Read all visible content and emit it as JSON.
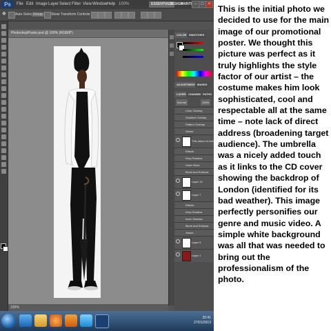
{
  "photoshop": {
    "logo": "Ps",
    "menu": [
      "File",
      "Edit",
      "Image",
      "Layer",
      "Select",
      "Filter",
      "View",
      "Window",
      "Help"
    ],
    "zoom": "100%",
    "workspaces": [
      "ESSENTIALS",
      "DESIGN",
      "PAINTING"
    ],
    "options_bar": {
      "auto_select": "Auto-Select:",
      "auto_select_value": "Group",
      "transform": "Show Transform Controls"
    },
    "document_tab": "PhotoshopPoster.psd @ 100% (RGB/8*)",
    "status_zoom": "100%",
    "panels": {
      "color_tabs": [
        "COLOR",
        "SWATCHES"
      ],
      "adjust_tabs": [
        "ADJUSTMENTS",
        "MASKS"
      ],
      "layers_tabs": [
        "LAYERS",
        "CHANNELS",
        "PATHS"
      ],
      "blend_mode": "Normal",
      "opacity": "100%",
      "layers": [
        {
          "name": "Color Overlay",
          "sub": true
        },
        {
          "name": "Gradient Overlay",
          "sub": true
        },
        {
          "name": "Pattern Overlay",
          "sub": true
        },
        {
          "name": "Stroke",
          "sub": true
        },
        {
          "name": "This album is included...",
          "sub": false
        },
        {
          "name": "Effects",
          "sub": true
        },
        {
          "name": "Drop Shadow",
          "sub": true
        },
        {
          "name": "Outer Glow",
          "sub": true
        },
        {
          "name": "Bevel and Emboss",
          "sub": true
        },
        {
          "name": "Layer 10",
          "sub": false
        },
        {
          "name": "Layer 7",
          "sub": false
        },
        {
          "name": "Effects",
          "sub": true
        },
        {
          "name": "Drop Shadow",
          "sub": true
        },
        {
          "name": "Inner Shadow",
          "sub": true
        },
        {
          "name": "Bevel and Emboss",
          "sub": true
        },
        {
          "name": "Stroke",
          "sub": true
        },
        {
          "name": "Layer 5",
          "sub": false
        },
        {
          "name": "Layer 1",
          "sub": false
        }
      ]
    },
    "colors": {
      "accent": "#1b3f6e",
      "taskbar_top": "#4c6f95",
      "taskbar_bottom": "#1f3a5a"
    }
  },
  "taskbar": {
    "clock_time": "20:41",
    "clock_date": "27/01/2013",
    "apps": [
      "ie-icon",
      "folder-icon",
      "firefox-icon",
      "media-icon",
      "skype-icon",
      "photoshop-icon"
    ]
  },
  "description": "This is the initial photo we decided to use for the main image of our promotional poster. We thought this picture was perfect as it truly highlights the style factor of our artist – the costume makes him look sophisticated, cool and respectable all at the same time – note lack of direct address (broadening target audience). The umbrella was a nicely added touch as it links to the CD cover showing the backdrop of London (identified for its bad weather). This image perfectly personifies our genre and music video. A simple white background was all that was needed to bring out the professionalism of the photo."
}
